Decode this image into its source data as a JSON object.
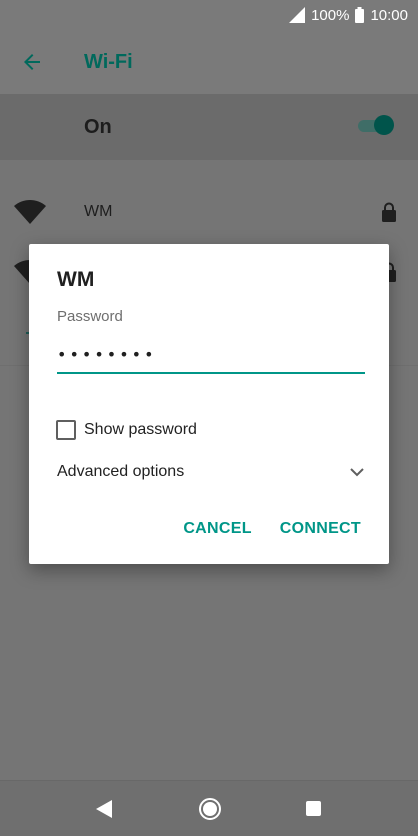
{
  "status_bar": {
    "battery": "100%",
    "time": "10:00",
    "icons": [
      "signal-icon",
      "battery-icon"
    ]
  },
  "app_bar": {
    "title": "Wi-Fi",
    "back_icon": "arrow-back-icon"
  },
  "wifi_toggle": {
    "label": "On",
    "state": "on"
  },
  "networks": [
    {
      "name": "WM",
      "icon": "wifi-icon",
      "locked": true
    },
    {
      "name": "",
      "icon": "wifi-icon",
      "locked": true
    }
  ],
  "dialog": {
    "title": "WM",
    "password_label": "Password",
    "password_value": "••••••••",
    "show_password_label": "Show password",
    "show_password_checked": false,
    "advanced_options_label": "Advanced options",
    "cancel_label": "CANCEL",
    "connect_label": "CONNECT"
  },
  "colors": {
    "accent": "#009688",
    "title_teal": "#00695c",
    "scrim": "#757575"
  }
}
